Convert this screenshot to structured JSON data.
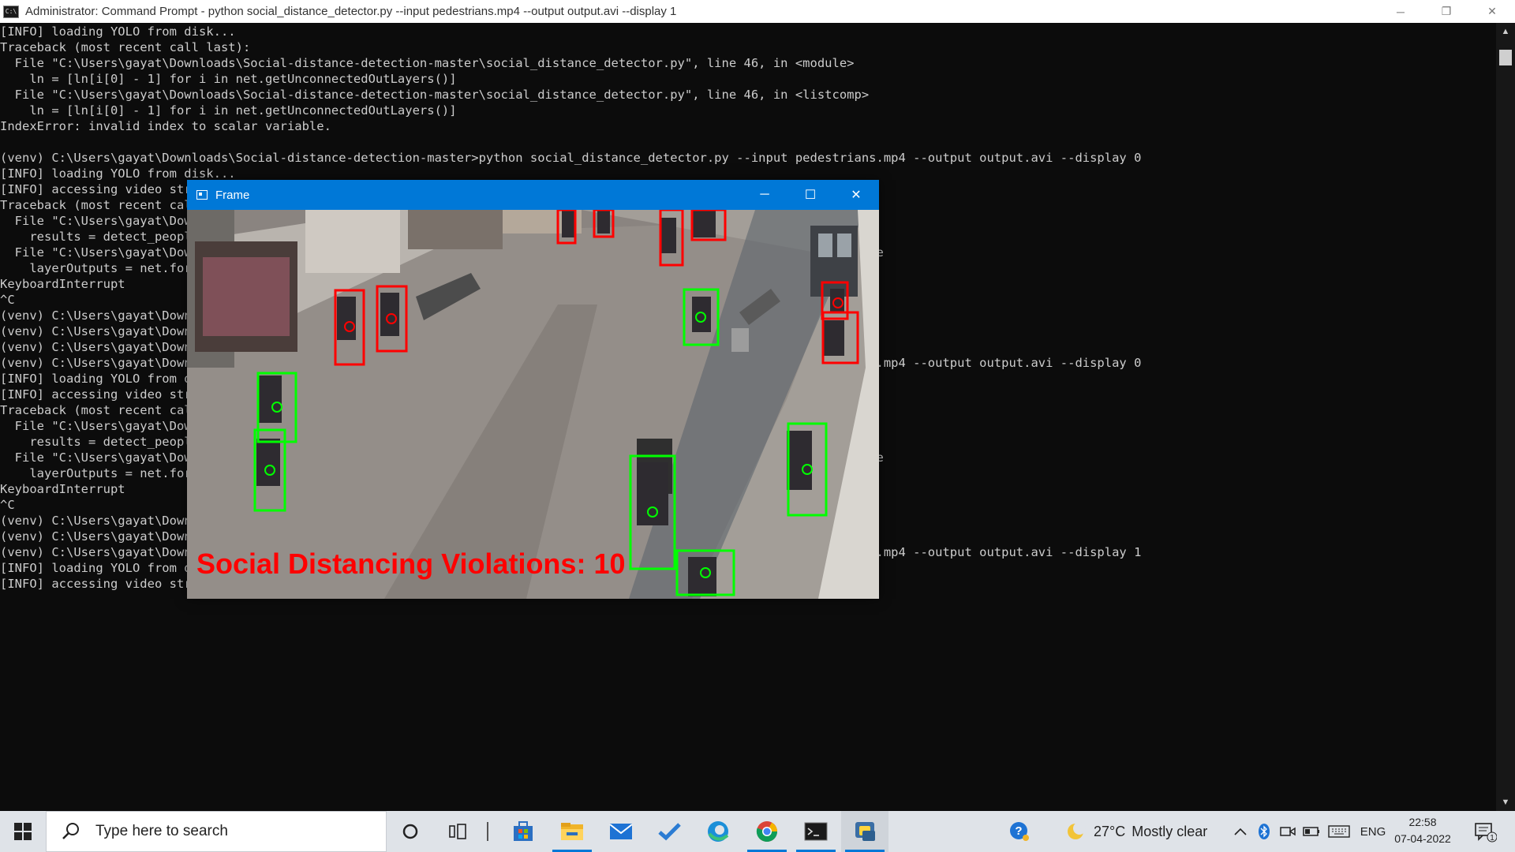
{
  "window": {
    "title": "Administrator: Command Prompt - python  social_distance_detector.py --input pedestrians.mp4 --output output.avi --display 1",
    "icon_label": "C:\\",
    "minimize": "─",
    "restore": "❐",
    "close": "✕"
  },
  "terminal": {
    "lines": [
      "[INFO] loading YOLO from disk...",
      "Traceback (most recent call last):",
      "  File \"C:\\Users\\gayat\\Downloads\\Social-distance-detection-master\\social_distance_detector.py\", line 46, in <module>",
      "    ln = [ln[i[0] - 1] for i in net.getUnconnectedOutLayers()]",
      "  File \"C:\\Users\\gayat\\Downloads\\Social-distance-detection-master\\social_distance_detector.py\", line 46, in <listcomp>",
      "    ln = [ln[i[0] - 1] for i in net.getUnconnectedOutLayers()]",
      "IndexError: invalid index to scalar variable.",
      "",
      "(venv) C:\\Users\\gayat\\Downloads\\Social-distance-detection-master>python social_distance_detector.py --input pedestrians.mp4 --output output.avi --display 0",
      "[INFO] loading YOLO from disk...",
      "[INFO] accessing video stream...",
      "Traceback (most recent call last):",
      "  File \"C:\\Users\\gayat\\Downloads\\Social-distance-detection-master\\social_distance_detector.py\", line 79, in <module>",
      "    results = detect_people(frame, net, ln, personIdx=LABELS.index(\"person\"))",
      "  File \"C:\\Users\\gayat\\Downloads\\Social-distance-detection-master\\pyimagesearch\\detection.py\", line 21, in detect_people",
      "    layerOutputs = net.forward(ln)",
      "KeyboardInterrupt",
      "^C",
      "(venv) C:\\Users\\gayat\\Downloads\\Social-distance-detection-master>",
      "(venv) C:\\Users\\gayat\\Downloads\\Social-distance-detection-master>",
      "(venv) C:\\Users\\gayat\\Downloads\\Social-distance-detection-master>",
      "(venv) C:\\Users\\gayat\\Downloads\\Social-distance-detection-master>python social_distance_detector.py --input pedestrians.mp4 --output output.avi --display 0",
      "[INFO] loading YOLO from disk...",
      "[INFO] accessing video stream...",
      "Traceback (most recent call last):",
      "  File \"C:\\Users\\gayat\\Downloads\\Social-distance-detection-master\\social_distance_detector.py\", line 79, in <module>",
      "    results = detect_people(frame, net, ln, personIdx=LABELS.index(\"person\"))",
      "  File \"C:\\Users\\gayat\\Downloads\\Social-distance-detection-master\\pyimagesearch\\detection.py\", line 21, in detect_people",
      "    layerOutputs = net.forward(ln)",
      "KeyboardInterrupt",
      "^C",
      "(venv) C:\\Users\\gayat\\Downloads\\Social-distance-detection-master>",
      "(venv) C:\\Users\\gayat\\Downloads\\Social-distance-detection-master>",
      "(venv) C:\\Users\\gayat\\Downloads\\Social-distance-detection-master>python social_distance_detector.py --input pedestrians.mp4 --output output.avi --display 1",
      "[INFO] loading YOLO from disk...",
      "[INFO] accessing video stream..."
    ]
  },
  "frame_window": {
    "title": "Frame",
    "minimize": "─",
    "maximize": "☐",
    "close": "✕",
    "overlay_text": "Social Distancing Violations: 10",
    "colors": {
      "violation": "#ff0000",
      "safe": "#00ff00",
      "overlay": "#ff0000"
    }
  },
  "taskbar": {
    "search_placeholder": "Type here to search",
    "apps": [
      "cortana-icon",
      "task-view-icon",
      "store-icon",
      "file-explorer-icon",
      "mail-icon",
      "todo-icon",
      "edge-icon",
      "chrome-icon",
      "terminal-icon",
      "python-icon"
    ],
    "weather": {
      "temp": "27°C",
      "condition": "Mostly clear"
    },
    "language": "ENG",
    "time": "22:58",
    "date": "07-04-2022",
    "notification_count": "1"
  }
}
